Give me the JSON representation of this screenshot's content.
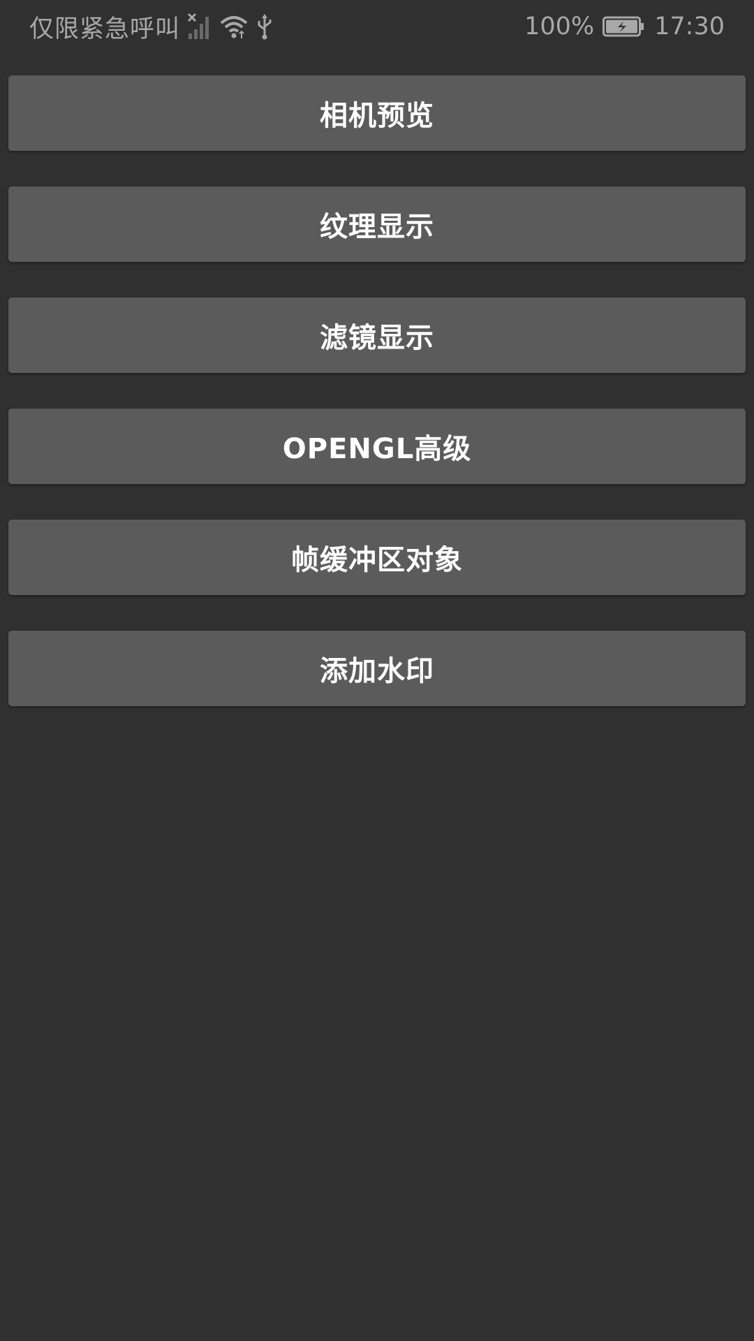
{
  "status_bar": {
    "carrier": "仅限紧急呼叫",
    "battery_percent": "100%",
    "time": "17:30",
    "icons": [
      "signal-no-sim-icon",
      "wifi-icon",
      "usb-icon",
      "battery-charging-icon"
    ]
  },
  "buttons": [
    {
      "label": "相机预览"
    },
    {
      "label": "纹理显示"
    },
    {
      "label": "滤镜显示"
    },
    {
      "label": "OPENGL高级"
    },
    {
      "label": "帧缓冲区对象"
    },
    {
      "label": "添加水印"
    }
  ],
  "colors": {
    "background": "#303030",
    "button": "#5b5b5c",
    "button_text": "#ffffff",
    "status_text": "#a8a8a8"
  }
}
